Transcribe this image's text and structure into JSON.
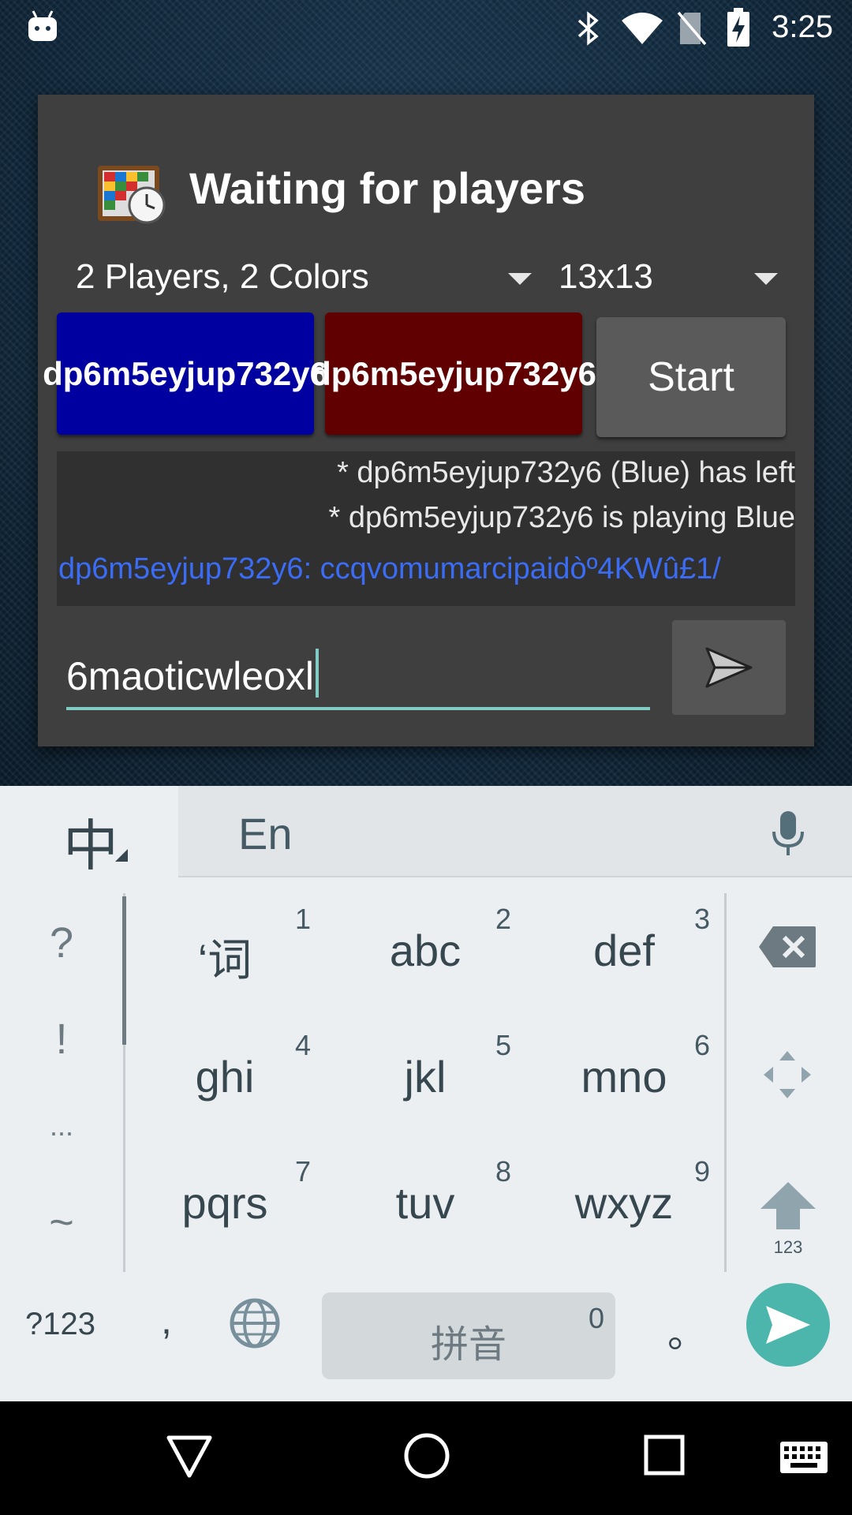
{
  "status_bar": {
    "time": "3:25",
    "icons": [
      "android-debug-icon",
      "bluetooth-icon",
      "wifi-icon",
      "no-sim-icon",
      "battery-charging-icon"
    ]
  },
  "dialog": {
    "title": "Waiting for players",
    "players_dropdown": "2 Players, 2 Colors",
    "size_dropdown": "13x13",
    "player_blue_name": "dp6m5eyjup732y6",
    "player_red_name": "dp6m5eyjup732y6",
    "start_label": "Start",
    "chat": {
      "system_line_1": "* dp6m5eyjup732y6 (Blue) has left",
      "system_line_2": "* dp6m5eyjup732y6 is playing Blue",
      "message": "dp6m5eyjup732y6:  ccqvomumarcipaidòº4KWû£1/"
    },
    "input_value": "6maoticwleoxl"
  },
  "colors": {
    "blue_player": "#0000a0",
    "red_player": "#600000",
    "accent": "#80cbc4",
    "chat_text": "#3b6cf5"
  },
  "keyboard": {
    "lang_switch": "中",
    "mode_label": "En",
    "side_symbols": [
      "?",
      "!",
      "...",
      "~"
    ],
    "keys": [
      {
        "label": "‘词",
        "num": "1"
      },
      {
        "label": "abc",
        "num": "2"
      },
      {
        "label": "def",
        "num": "3"
      },
      {
        "label": "ghi",
        "num": "4"
      },
      {
        "label": "jkl",
        "num": "5"
      },
      {
        "label": "mno",
        "num": "6"
      },
      {
        "label": "pqrs",
        "num": "7"
      },
      {
        "label": "tuv",
        "num": "8"
      },
      {
        "label": "wxyz",
        "num": "9"
      }
    ],
    "shift_label": "123",
    "sym_switch": "?123",
    "comma": ",",
    "space_label": "拼音",
    "space_num": "0",
    "period": "。"
  }
}
